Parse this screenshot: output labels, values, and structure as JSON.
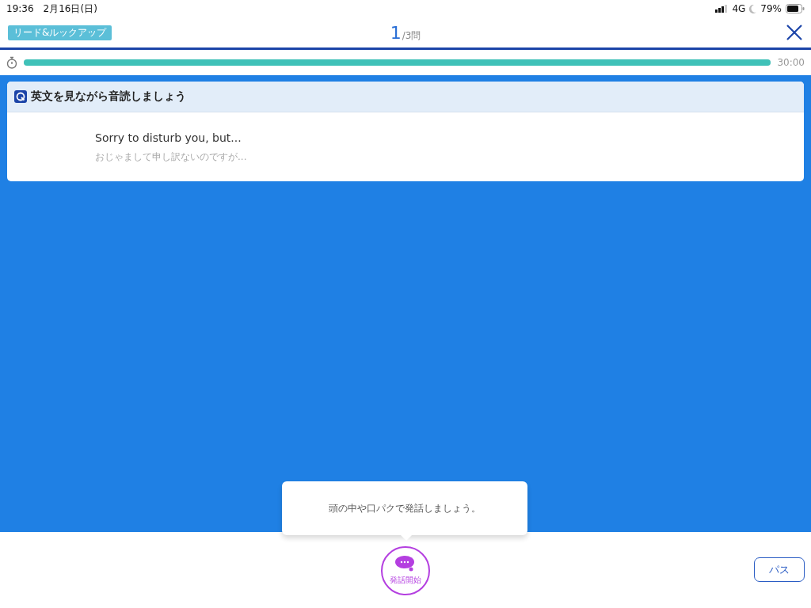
{
  "status_bar": {
    "time": "19:36",
    "date": "2月16日(日)",
    "network": "4G",
    "battery": "79%"
  },
  "header": {
    "mode_badge": "リード&ルックアップ",
    "question_number": "1",
    "question_total": "/3問"
  },
  "timer": {
    "level": 1,
    "time": "30:00"
  },
  "card": {
    "title": "英文を見ながら音読しましょう",
    "sentence": "Sorry to disturb you, but...",
    "translation": "おじゃまして申し訳ないのですが..."
  },
  "tooltip": "頭の中や口パクで発話しましょう。",
  "speak_button": {
    "label": "発話開始"
  },
  "pass_button": "パス"
}
